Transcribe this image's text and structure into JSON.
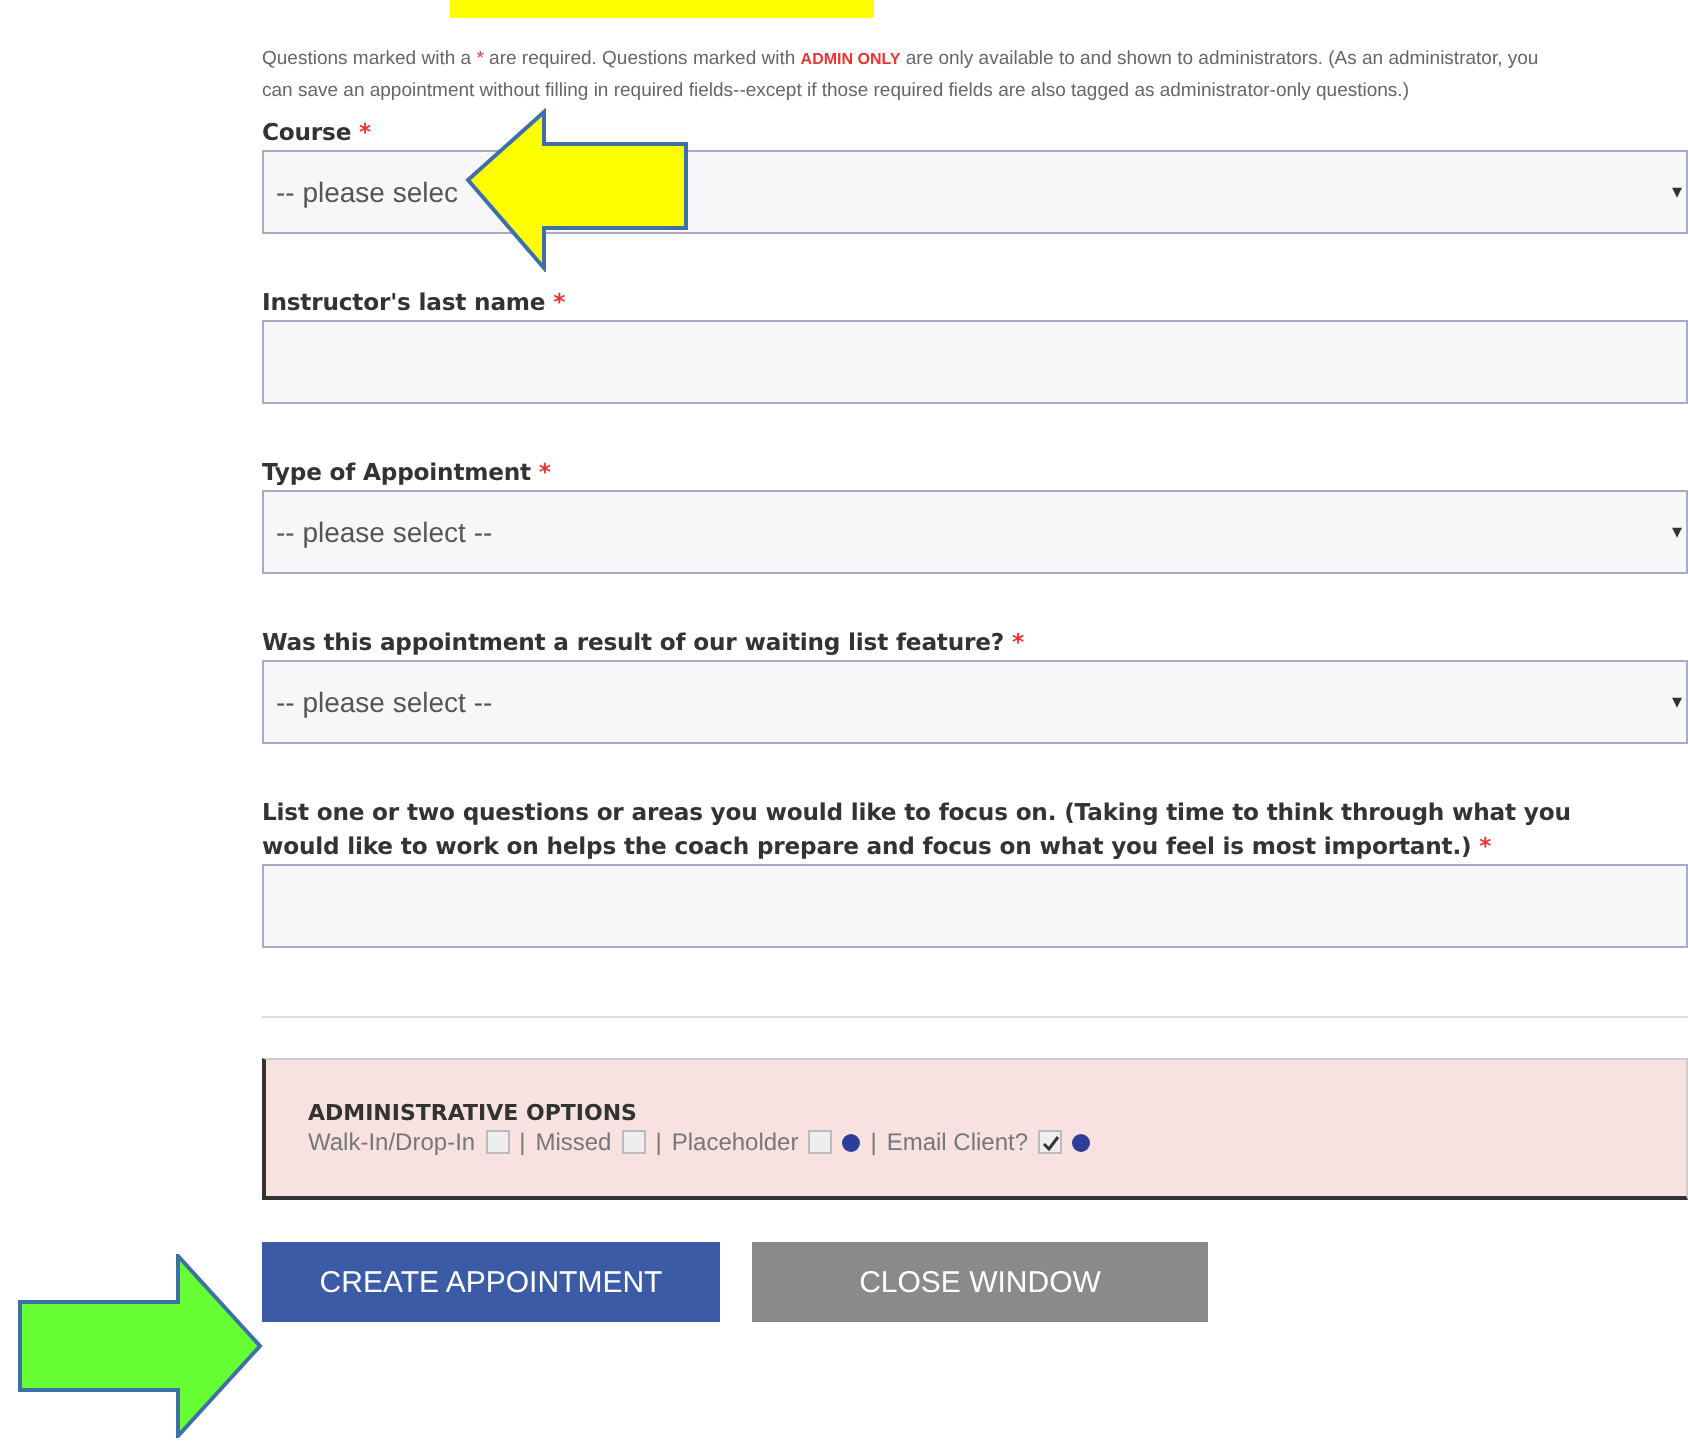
{
  "intro": [
    {
      "kind": "plain",
      "text": "Questions marked with a "
    },
    {
      "kind": "red",
      "text": "*"
    },
    {
      "kind": "plain",
      "text": " are required. Questions marked with "
    },
    {
      "kind": "tag",
      "text": "ADMIN ONLY"
    },
    {
      "kind": "plain",
      "text": " are only available to and shown to administrators. (As an administrator, you can save an appointment without filling in required fields--except if those required fields are also tagged as administrator-only questions.)"
    }
  ],
  "fields": [
    {
      "kind": "select",
      "label_lines": [
        "Course"
      ],
      "required_mark": "*",
      "value": "-- please selec",
      "caret": "▾"
    },
    {
      "kind": "text",
      "label_lines": [
        "Instructor's last name"
      ],
      "required_mark": "*"
    },
    {
      "kind": "select",
      "label_lines": [
        "Type of Appointment"
      ],
      "required_mark": "*",
      "value": "-- please select --",
      "caret": "▾"
    },
    {
      "kind": "select",
      "label_lines": [
        "Was this appointment a result of our waiting list feature?"
      ],
      "required_mark": "*",
      "value": "-- please select --",
      "caret": "▾"
    },
    {
      "kind": "text",
      "label_lines": [
        "List one or two questions or areas you would like to focus on. (Taking time to think through what you",
        "would like to work on helps the coach prepare and focus on what you feel is most important.)"
      ],
      "required_mark": "*"
    }
  ],
  "admin_options": {
    "title": "ADMINISTRATIVE OPTIONS",
    "separator": "|",
    "options": [
      {
        "label": "Walk-In/Drop-In",
        "checked": false,
        "info": false
      },
      {
        "label": "Missed",
        "checked": false,
        "info": false
      },
      {
        "label": "Placeholder",
        "checked": false,
        "info": true
      },
      {
        "label": "Email Client?",
        "checked": true,
        "info": true
      }
    ]
  },
  "buttons": [
    {
      "kind": "primary",
      "label": "CREATE APPOINTMENT"
    },
    {
      "kind": "secondary",
      "label": "CLOSE WINDOW"
    }
  ]
}
